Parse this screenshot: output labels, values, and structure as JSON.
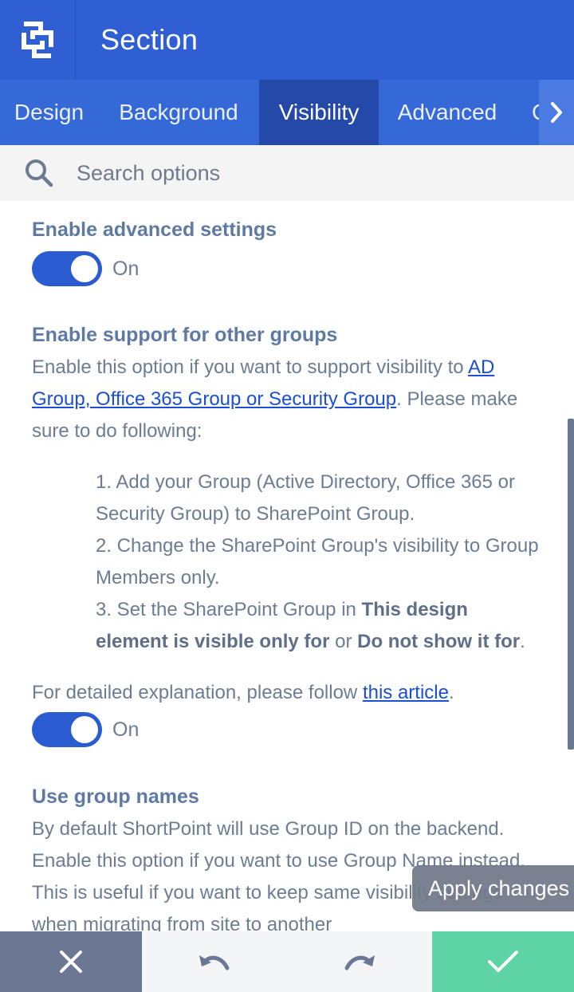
{
  "header": {
    "title": "Section",
    "logo_icon": "shortpoint-logo-icon"
  },
  "tabs": [
    {
      "label": "Design",
      "active": false
    },
    {
      "label": "Background",
      "active": false
    },
    {
      "label": "Visibility",
      "active": true
    },
    {
      "label": "Advanced",
      "active": false
    },
    {
      "label": "C",
      "active": false
    }
  ],
  "search": {
    "placeholder": "Search options"
  },
  "settings": {
    "advanced": {
      "label": "Enable advanced settings",
      "toggle_state": "On"
    },
    "groups": {
      "label": "Enable support for other groups",
      "intro_before_link": "Enable this option if you want to support visibility to ",
      "intro_link": "AD Group, Office 365 Group or Security Group",
      "intro_after_link": ". Please make sure to do following:",
      "steps": [
        {
          "text": "1. Add your Group (Active Directory, Office 365 or Security Group) to SharePoint Group."
        },
        {
          "text": "2. Change the SharePoint Group's visibility to Group Members only."
        },
        {
          "prefix": "3. Set the SharePoint Group in ",
          "bold1": "This design element is visible only for",
          "mid": " or ",
          "bold2": "Do not show it for",
          "suffix": "."
        }
      ],
      "footer_before_link": "For detailed explanation, please follow ",
      "footer_link": "this article",
      "footer_after_link": ".",
      "toggle_state": "On"
    },
    "group_names": {
      "label": "Use group names",
      "text": "By default ShortPoint will use Group ID on the backend. Enable this option if you want to use Group Name instead. This is useful if you want to keep same visibility settings when migrating from site to another"
    }
  },
  "apply_changes": {
    "label": "Apply changes"
  },
  "bottom_bar": {
    "close_icon": "close-icon",
    "undo_icon": "undo-icon",
    "redo_icon": "redo-icon",
    "confirm_icon": "checkmark-icon"
  },
  "colors": {
    "header": "#2f5fd3",
    "tabs": "#3669d8",
    "active_tab": "#2549a8",
    "toggle_on": "#2a5bd0",
    "confirm": "#5ed3a6",
    "close": "#6c7794"
  }
}
